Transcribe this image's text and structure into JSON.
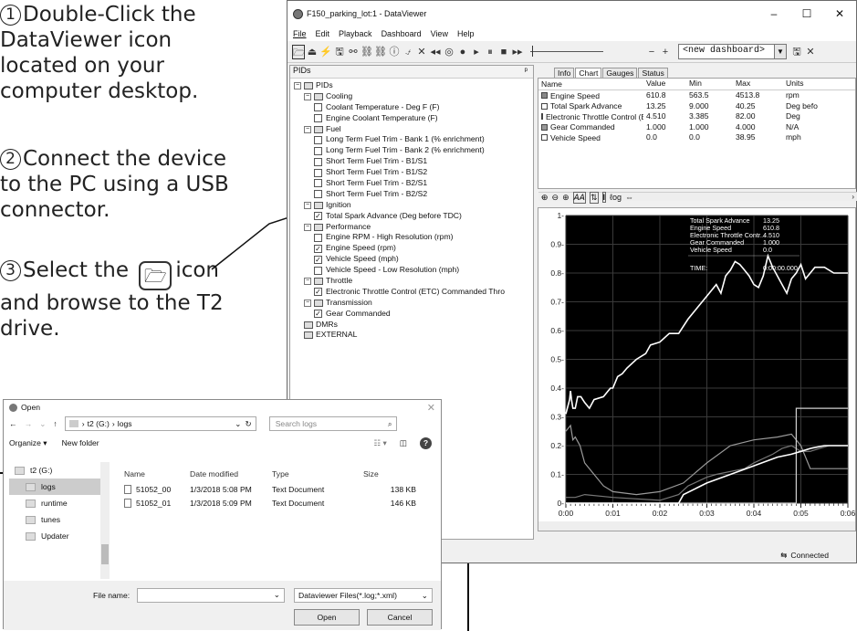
{
  "instructions": {
    "step1_num": "1",
    "step1_lines": [
      "Double-Click the",
      "DataViewer icon",
      "located on your",
      "computer desktop."
    ],
    "step2_num": "2",
    "step2_lines": [
      "Connect the device",
      "to the PC using a USB",
      "connector."
    ],
    "step3_num": "3",
    "step3_pre": "Select the",
    "step3_post": "icon",
    "step3_lines": [
      "and browse to the T2",
      "drive."
    ]
  },
  "window": {
    "title": "F150_parking_lot:1 - DataViewer",
    "minimize": "–",
    "maximize": "☐",
    "close": "✕",
    "menus": [
      "File",
      "Edit",
      "Playback",
      "Dashboard",
      "View",
      "Help"
    ],
    "dashboard": "<new dashboard>"
  },
  "tree": {
    "header": "PIDs",
    "pin": "ᵖ",
    "rows": [
      {
        "level": 0,
        "kind": "group",
        "label": "PIDs",
        "exp": "−"
      },
      {
        "level": 1,
        "kind": "cat",
        "label": "Cooling",
        "exp": "−"
      },
      {
        "level": 2,
        "kind": "item",
        "label": "Coolant Temperature - Deg F (F)",
        "checked": false
      },
      {
        "level": 2,
        "kind": "item",
        "label": "Engine Coolant Temperature (F)",
        "checked": false
      },
      {
        "level": 1,
        "kind": "cat",
        "label": "Fuel",
        "exp": "−"
      },
      {
        "level": 2,
        "kind": "item",
        "label": "Long Term Fuel Trim - Bank 1 (% enrichment)",
        "checked": false
      },
      {
        "level": 2,
        "kind": "item",
        "label": "Long Term Fuel Trim - Bank 2 (% enrichment)",
        "checked": false
      },
      {
        "level": 2,
        "kind": "item",
        "label": "Short Term Fuel Trim - B1/S1",
        "checked": false
      },
      {
        "level": 2,
        "kind": "item",
        "label": "Short Term Fuel Trim - B1/S2",
        "checked": false
      },
      {
        "level": 2,
        "kind": "item",
        "label": "Short Term Fuel Trim - B2/S1",
        "checked": false
      },
      {
        "level": 2,
        "kind": "item",
        "label": "Short Term Fuel Trim - B2/S2",
        "checked": false
      },
      {
        "level": 1,
        "kind": "cat",
        "label": "Ignition",
        "exp": "−"
      },
      {
        "level": 2,
        "kind": "item",
        "label": "Total Spark Advance (Deg before TDC)",
        "checked": true
      },
      {
        "level": 1,
        "kind": "cat",
        "label": "Performance",
        "exp": "−"
      },
      {
        "level": 2,
        "kind": "item",
        "label": "Engine RPM - High Resolution (rpm)",
        "checked": false
      },
      {
        "level": 2,
        "kind": "item",
        "label": "Engine Speed (rpm)",
        "checked": true
      },
      {
        "level": 2,
        "kind": "item",
        "label": "Vehicle Speed (mph)",
        "checked": true
      },
      {
        "level": 2,
        "kind": "item",
        "label": "Vehicle Speed - Low Resolution (mph)",
        "checked": false
      },
      {
        "level": 1,
        "kind": "cat",
        "label": "Throttle",
        "exp": "−"
      },
      {
        "level": 2,
        "kind": "item",
        "label": "Electronic Throttle Control (ETC) Commanded Thro",
        "checked": true
      },
      {
        "level": 1,
        "kind": "cat",
        "label": "Transmission",
        "exp": "−"
      },
      {
        "level": 2,
        "kind": "item",
        "label": "Gear Commanded",
        "checked": true
      },
      {
        "level": 0,
        "kind": "group",
        "label": "DMRs",
        "exp": ""
      },
      {
        "level": 0,
        "kind": "group",
        "label": "EXTERNAL",
        "exp": ""
      }
    ]
  },
  "tabs": [
    "Info",
    "Chart",
    "Gauges",
    "Status"
  ],
  "table": {
    "headers": [
      "Name",
      "Value",
      "Min",
      "Max",
      "Units"
    ],
    "rows": [
      {
        "name": "Engine Speed",
        "value": "610.8",
        "min": "563.5",
        "max": "4513.8",
        "units": "rpm",
        "swatch": "#888888"
      },
      {
        "name": "Total Spark Advance",
        "value": "13.25",
        "min": "9.000",
        "max": "40.25",
        "units": "Deg befo",
        "swatch": "#ffffff"
      },
      {
        "name": "Electronic Throttle Control (ET...",
        "value": "4.510",
        "min": "3.385",
        "max": "82.00",
        "units": "Deg",
        "swatch": "#333333"
      },
      {
        "name": "Gear Commanded",
        "value": "1.000",
        "min": "1.000",
        "max": "4.000",
        "units": "N/A",
        "swatch": "#999999"
      },
      {
        "name": "Vehicle Speed",
        "value": "0.0",
        "min": "0.0",
        "max": "38.95",
        "units": "mph",
        "swatch": "#ffffff"
      }
    ]
  },
  "zoom_tools": [
    "⊕",
    "⊖",
    "⊕",
    "𝘈𝘈",
    "⇅",
    "I",
    "ℓog",
    "⇔"
  ],
  "chart_data": {
    "type": "line",
    "ylim": [
      0,
      1
    ],
    "yticks": [
      "1-",
      "0.9-",
      "0.8-",
      "0.7-",
      "0.6-",
      "0.5-",
      "0.4-",
      "0.3-",
      "0.2-",
      "0.1-",
      "0-"
    ],
    "xticks": [
      "0:00",
      "0:01",
      "0:02",
      "0:03",
      "0:04",
      "0:05",
      "0:06"
    ],
    "overlay": {
      "lines": [
        {
          "label": "Total Spark Advance",
          "value": "13.25"
        },
        {
          "label": "Engine Speed",
          "value": "610.8"
        },
        {
          "label": "Electronic Throttle Contr...",
          "value": "4.510"
        },
        {
          "label": "Gear Commanded",
          "value": "1.000"
        },
        {
          "label": "Vehicle Speed",
          "value": "0.0"
        }
      ],
      "time_label": "TIME:",
      "time_value": "0:00:00.000"
    },
    "series": [
      {
        "x": [
          0,
          0.08,
          0.1,
          0.12,
          0.15,
          0.2,
          0.25,
          0.32,
          0.4,
          0.5,
          0.6,
          0.8,
          0.9,
          0.95,
          1.0,
          1.1,
          1.2,
          1.3,
          1.5,
          1.7,
          1.8,
          2.0,
          2.2,
          2.4,
          2.6,
          2.8,
          3.0,
          3.1,
          3.2,
          3.3,
          3.4,
          3.5,
          3.6,
          3.7,
          3.8,
          3.9,
          4.0,
          4.1,
          4.2,
          4.3,
          4.4,
          4.6,
          4.7,
          4.8,
          4.9,
          5.0,
          5.1,
          5.3,
          5.5,
          5.7,
          5.9,
          6.0
        ],
        "y": [
          0.31,
          0.36,
          0.39,
          0.36,
          0.33,
          0.33,
          0.37,
          0.37,
          0.35,
          0.33,
          0.36,
          0.37,
          0.39,
          0.4,
          0.4,
          0.44,
          0.45,
          0.47,
          0.5,
          0.52,
          0.55,
          0.56,
          0.59,
          0.59,
          0.64,
          0.68,
          0.72,
          0.74,
          0.76,
          0.73,
          0.79,
          0.81,
          0.84,
          0.83,
          0.81,
          0.79,
          0.76,
          0.75,
          0.79,
          0.86,
          0.82,
          0.76,
          0.73,
          0.78,
          0.8,
          0.83,
          0.78,
          0.82,
          0.82,
          0.8,
          0.8,
          0.8
        ]
      },
      {
        "x": [
          0,
          0.1,
          0.15,
          0.2,
          0.3,
          0.4,
          0.6,
          0.8,
          1.0,
          1.5,
          2.0,
          2.5,
          3.0,
          3.5,
          4.0,
          4.5,
          4.8,
          5.0,
          5.2,
          6.0
        ],
        "y": [
          0.25,
          0.27,
          0.22,
          0.23,
          0.2,
          0.14,
          0.1,
          0.06,
          0.04,
          0.03,
          0.04,
          0.07,
          0.14,
          0.2,
          0.22,
          0.23,
          0.24,
          0.2,
          0.12,
          0.12
        ]
      },
      {
        "x": [
          0,
          0.2,
          0.4,
          1.0,
          2.0,
          2.4,
          2.6,
          3.0,
          3.2,
          3.8,
          4.0,
          4.4,
          4.6,
          4.8,
          5.0,
          5.2,
          5.4,
          5.6,
          6.0
        ],
        "y": [
          0.02,
          0.02,
          0.03,
          0.02,
          0.01,
          0.03,
          0.06,
          0.09,
          0.1,
          0.12,
          0.14,
          0.17,
          0.19,
          0.2,
          0.18,
          0.18,
          0.19,
          0.2,
          0.2
        ]
      },
      {
        "x": [
          0,
          4.9,
          4.9,
          6.0
        ],
        "y": [
          0.0,
          0.0,
          0.33,
          0.33
        ]
      },
      {
        "x": [
          0,
          2.4,
          2.5,
          3.0,
          3.5,
          4.0,
          4.5,
          4.8,
          5.0,
          5.2,
          5.5,
          6.0
        ],
        "y": [
          0.0,
          0.0,
          0.03,
          0.07,
          0.1,
          0.13,
          0.16,
          0.17,
          0.18,
          0.19,
          0.2,
          0.2
        ]
      }
    ]
  },
  "status": {
    "connected": "Connected"
  },
  "dialog": {
    "title": "Open",
    "close": "✕",
    "path_parts": [
      "t2 (G:)",
      "logs"
    ],
    "search_placeholder": "Search logs",
    "organize": "Organize ▾",
    "new_folder": "New folder",
    "nav_items": [
      {
        "label": "t2 (G:)",
        "selected": false,
        "indent": 0
      },
      {
        "label": "logs",
        "selected": true,
        "indent": 1
      },
      {
        "label": "runtime",
        "selected": false,
        "indent": 1
      },
      {
        "label": "tunes",
        "selected": false,
        "indent": 1
      },
      {
        "label": "Updater",
        "selected": false,
        "indent": 1
      }
    ],
    "file_headers": [
      "Name",
      "Date modified",
      "Type",
      "Size"
    ],
    "files": [
      {
        "name": "51052_00",
        "date": "1/3/2018 5:08 PM",
        "type": "Text Document",
        "size": "138 KB"
      },
      {
        "name": "51052_01",
        "date": "1/3/2018 5:09 PM",
        "type": "Text Document",
        "size": "146 KB"
      }
    ],
    "file_name_label": "File name:",
    "file_type": "Dataviewer Files(*.log;*.xml)",
    "open": "Open",
    "cancel": "Cancel"
  }
}
